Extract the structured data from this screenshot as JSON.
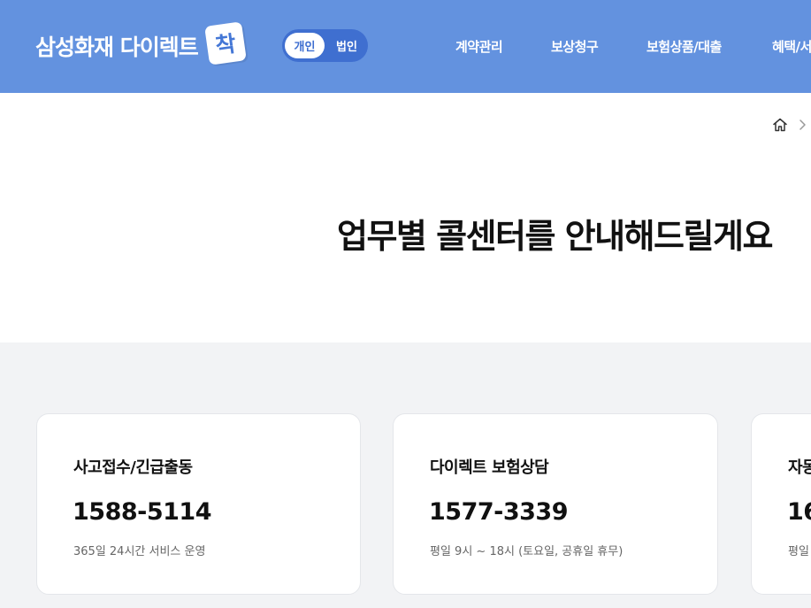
{
  "header": {
    "brand": "삼성화재 다이렉트",
    "brand_badge": "착",
    "toggle": {
      "personal": "개인",
      "corporate": "법인"
    },
    "nav": [
      "계약관리",
      "보상청구",
      "보험상품/대출",
      "혜택/서"
    ]
  },
  "breadcrumb": {
    "home_icon": "home-icon",
    "separator_icon": "chevron-right-icon"
  },
  "page": {
    "title": "업무별 콜센터를 안내해드릴게요"
  },
  "cards": [
    {
      "title": "사고접수/긴급출동",
      "phone": "1588-5114",
      "desc": "365일 24시간 서비스 운영"
    },
    {
      "title": "다이렉트 보험상담",
      "phone": "1577-3339",
      "desc": "평일 9시 ~ 18시 (토요일, 공휴일 휴무)"
    },
    {
      "title": "자동",
      "phone": "16",
      "desc": "평일"
    }
  ],
  "colors": {
    "header_bg": "#6392df",
    "toggle_bg": "#3f6fd0",
    "page_bg": "#f2f3f5"
  }
}
